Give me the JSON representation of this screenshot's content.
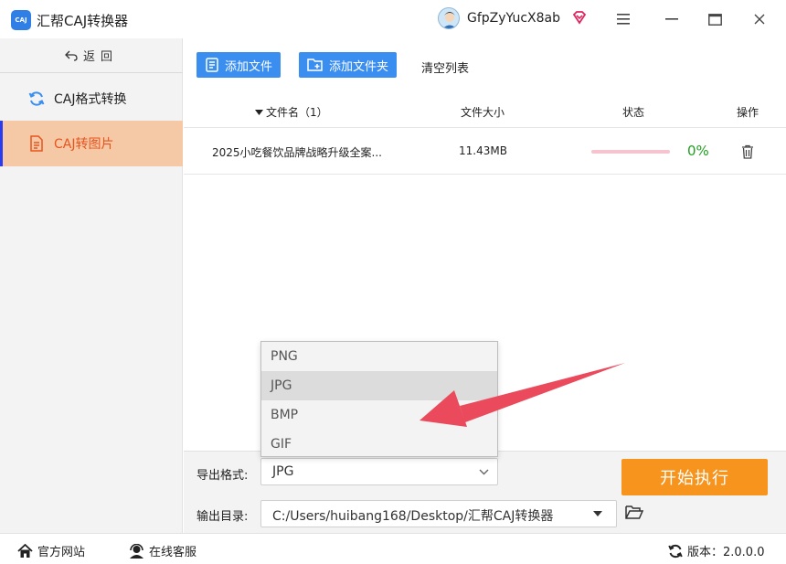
{
  "app": {
    "logo_text": "CAJ",
    "title": "汇帮CAJ转换器",
    "username": "GfpZyYucX8ab"
  },
  "sidebar": {
    "back_label": "返回",
    "items": [
      {
        "label": "CAJ格式转换",
        "icon": "refresh-icon",
        "active": false
      },
      {
        "label": "CAJ转图片",
        "icon": "document-icon",
        "active": true
      }
    ]
  },
  "toolbar": {
    "add_file_label": "添加文件",
    "add_folder_label": "添加文件夹",
    "clear_label": "清空列表"
  },
  "table": {
    "columns": {
      "name": "文件名（1）",
      "size": "文件大小",
      "status": "状态",
      "action": "操作"
    },
    "rows": [
      {
        "name": "2025小吃餐饮品牌战略升级全案...",
        "size": "11.43MB",
        "progress_percent": 0,
        "percent_label": "0%"
      }
    ]
  },
  "settings": {
    "format_label": "导出格式:",
    "format_value": "JPG",
    "format_options": [
      "PNG",
      "JPG",
      "BMP",
      "GIF"
    ],
    "output_label": "输出目录:",
    "output_path": "C:/Users/huibang168/Desktop/汇帮CAJ转换器",
    "start_label": "开始执行"
  },
  "footer": {
    "website_label": "官方网站",
    "support_label": "在线客服",
    "version_label": "版本：2.0.0.0"
  },
  "colors": {
    "primary_blue": "#3a8ef0",
    "active_bg": "#f6c9a6",
    "active_text": "#e8541f",
    "start_orange": "#f7941d",
    "percent_green": "#20a020",
    "arrow_red": "#ea4a5b"
  }
}
